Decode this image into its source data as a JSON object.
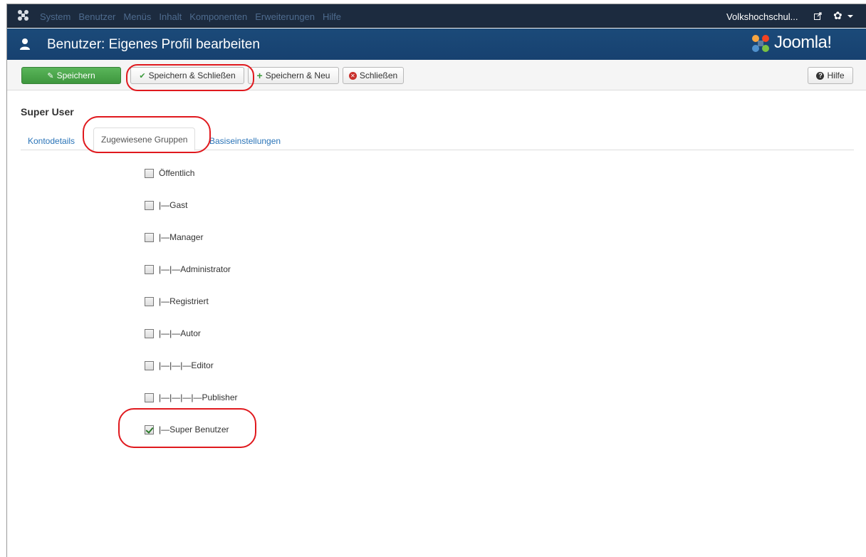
{
  "topnav": {
    "menu": [
      "System",
      "Benutzer",
      "Menüs",
      "Inhalt",
      "Komponenten",
      "Erweiterungen",
      "Hilfe"
    ],
    "site_name": "Volkshochschul..."
  },
  "header": {
    "title": "Benutzer: Eigenes Profil bearbeiten",
    "brand": "Joomla!"
  },
  "toolbar": {
    "save_label": "Speichern",
    "save_close_label": "Speichern & Schließen",
    "save_new_label": "Speichern & Neu",
    "close_label": "Schließen",
    "help_label": "Hilfe"
  },
  "form": {
    "title": "Super User",
    "tabs": [
      "Kontodetails",
      "Zugewiesene Gruppen",
      "Basiseinstellungen"
    ],
    "active_tab": "Zugewiesene Gruppen"
  },
  "groups": [
    {
      "label": "Öffentlich",
      "checked": false
    },
    {
      "label": "|—Gast",
      "checked": false
    },
    {
      "label": "|—Manager",
      "checked": false
    },
    {
      "label": "|—|—Administrator",
      "checked": false
    },
    {
      "label": "|—Registriert",
      "checked": false
    },
    {
      "label": "|—|—Autor",
      "checked": false
    },
    {
      "label": "|—|—|—Editor",
      "checked": false
    },
    {
      "label": "|—|—|—|—Publisher",
      "checked": false
    },
    {
      "label": "|—Super Benutzer",
      "checked": true
    }
  ],
  "colors": {
    "topnav_bg": "#1c2b3f",
    "header_bg": "#174170",
    "save_green": "#46a546",
    "highlight_red": "#e0191e",
    "link_blue": "#2a74b8"
  }
}
